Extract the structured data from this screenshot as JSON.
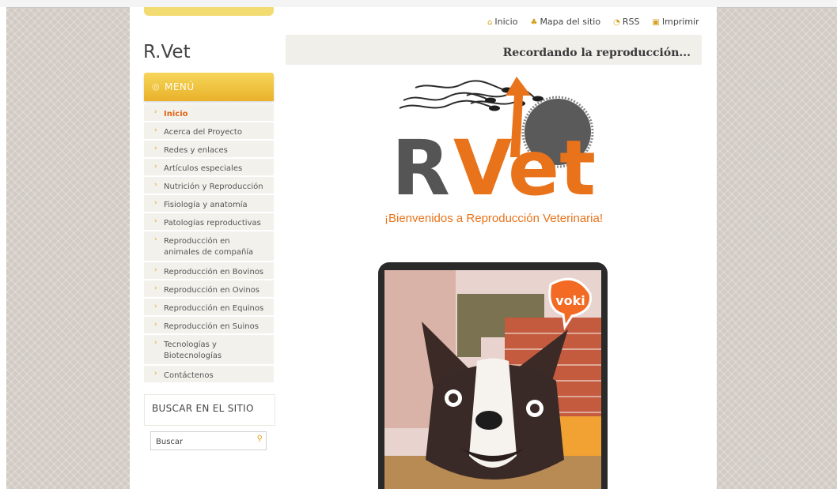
{
  "top_links": [
    {
      "icon": "home-icon",
      "label": "Inicio"
    },
    {
      "icon": "sitemap-icon",
      "label": "Mapa del sitio"
    },
    {
      "icon": "rss-icon",
      "label": "RSS"
    },
    {
      "icon": "print-icon",
      "label": "Imprimir"
    }
  ],
  "site": {
    "title": "R.Vet"
  },
  "header": {
    "title": "Recordando la reproducción..."
  },
  "menu": {
    "heading": "MENÚ",
    "items": [
      {
        "label": "Inicio",
        "active": true
      },
      {
        "label": "Acerca del Proyecto"
      },
      {
        "label": "Redes y enlaces"
      },
      {
        "label": "Artículos especiales"
      },
      {
        "label": "Nutrición y Reproducción"
      },
      {
        "label": "Fisiología y anatomía"
      },
      {
        "label": "Patologías reproductivas"
      },
      {
        "label": "Reproducción en animales de compañía"
      },
      {
        "label": "Reproducción en Bovinos"
      },
      {
        "label": "Reproducción en Ovinos"
      },
      {
        "label": "Reproducción en Equinos"
      },
      {
        "label": "Reproducción en Suinos"
      },
      {
        "label": "Tecnologías y Biotecnologías"
      },
      {
        "label": "Contáctenos"
      }
    ]
  },
  "search": {
    "heading": "BUSCAR EN EL SITIO",
    "placeholder": "Buscar"
  },
  "main": {
    "logo": {
      "letter_r": "R",
      "letters_vet": "Vet"
    },
    "welcome": "¡Bienvenidos a Reproducción Veterinaria!",
    "voki_badge": "voki"
  },
  "colors": {
    "accent": "#e8731a",
    "menu_gold": "#f1c643",
    "logo_gray": "#555555"
  }
}
